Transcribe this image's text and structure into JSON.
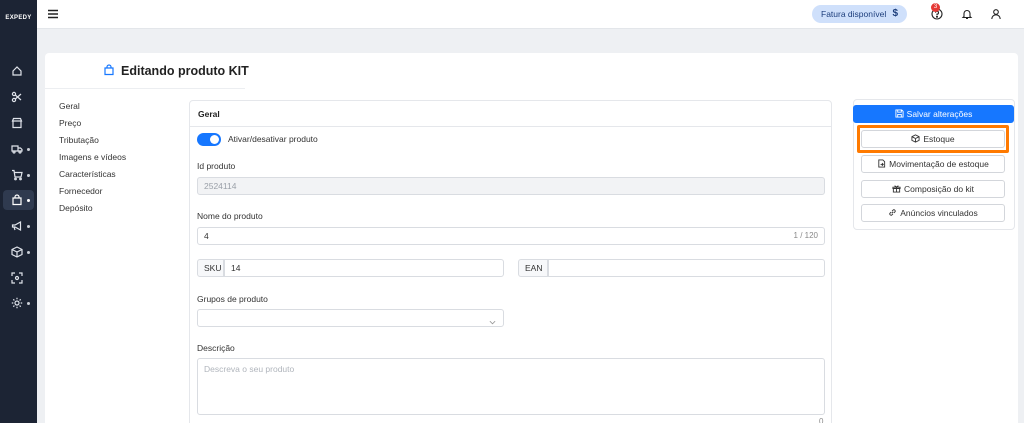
{
  "sidebar": {
    "logo": "EXPEDY",
    "items": [
      {
        "icon": "home-icon",
        "dot": false
      },
      {
        "icon": "scissors-icon",
        "dot": false
      },
      {
        "icon": "store-icon",
        "dot": false
      },
      {
        "icon": "truck-icon",
        "dot": true
      },
      {
        "icon": "cart-icon",
        "dot": true
      },
      {
        "icon": "bag-icon",
        "dot": true,
        "active": true
      },
      {
        "icon": "megaphone-icon",
        "dot": true
      },
      {
        "icon": "box-icon",
        "dot": true
      },
      {
        "icon": "scan-icon",
        "dot": false
      },
      {
        "icon": "gear-icon",
        "dot": true
      }
    ]
  },
  "topbar": {
    "invoice_label": "Fatura disponível",
    "invoice_symbol": "$",
    "notification_count": "3"
  },
  "page": {
    "title": "Editando produto KIT"
  },
  "nav": [
    "Geral",
    "Preço",
    "Tributação",
    "Imagens e vídeos",
    "Características",
    "Fornecedor",
    "Depósito"
  ],
  "form": {
    "section_title": "Geral",
    "toggle_label": "Ativar/desativar produto",
    "id_label": "Id produto",
    "id_value": "2524114",
    "name_label": "Nome do produto",
    "name_value": "4",
    "name_counter": "1 / 120",
    "sku_label": "SKU",
    "sku_value": "14",
    "ean_label": "EAN",
    "ean_value": "",
    "groups_label": "Grupos de produto",
    "description_label": "Descrição",
    "description_placeholder": "Descreva o seu produto",
    "description_counter": "0"
  },
  "actions": {
    "save": "Salvar alterações",
    "stock": "Estoque",
    "stock_movement": "Movimentação de estoque",
    "kit_composition": "Composição do kit",
    "linked_ads": "Anúncios vinculados"
  },
  "colors": {
    "sidebar": "#1c2434",
    "primary": "#1677ff",
    "highlight": "#ff7a00"
  }
}
